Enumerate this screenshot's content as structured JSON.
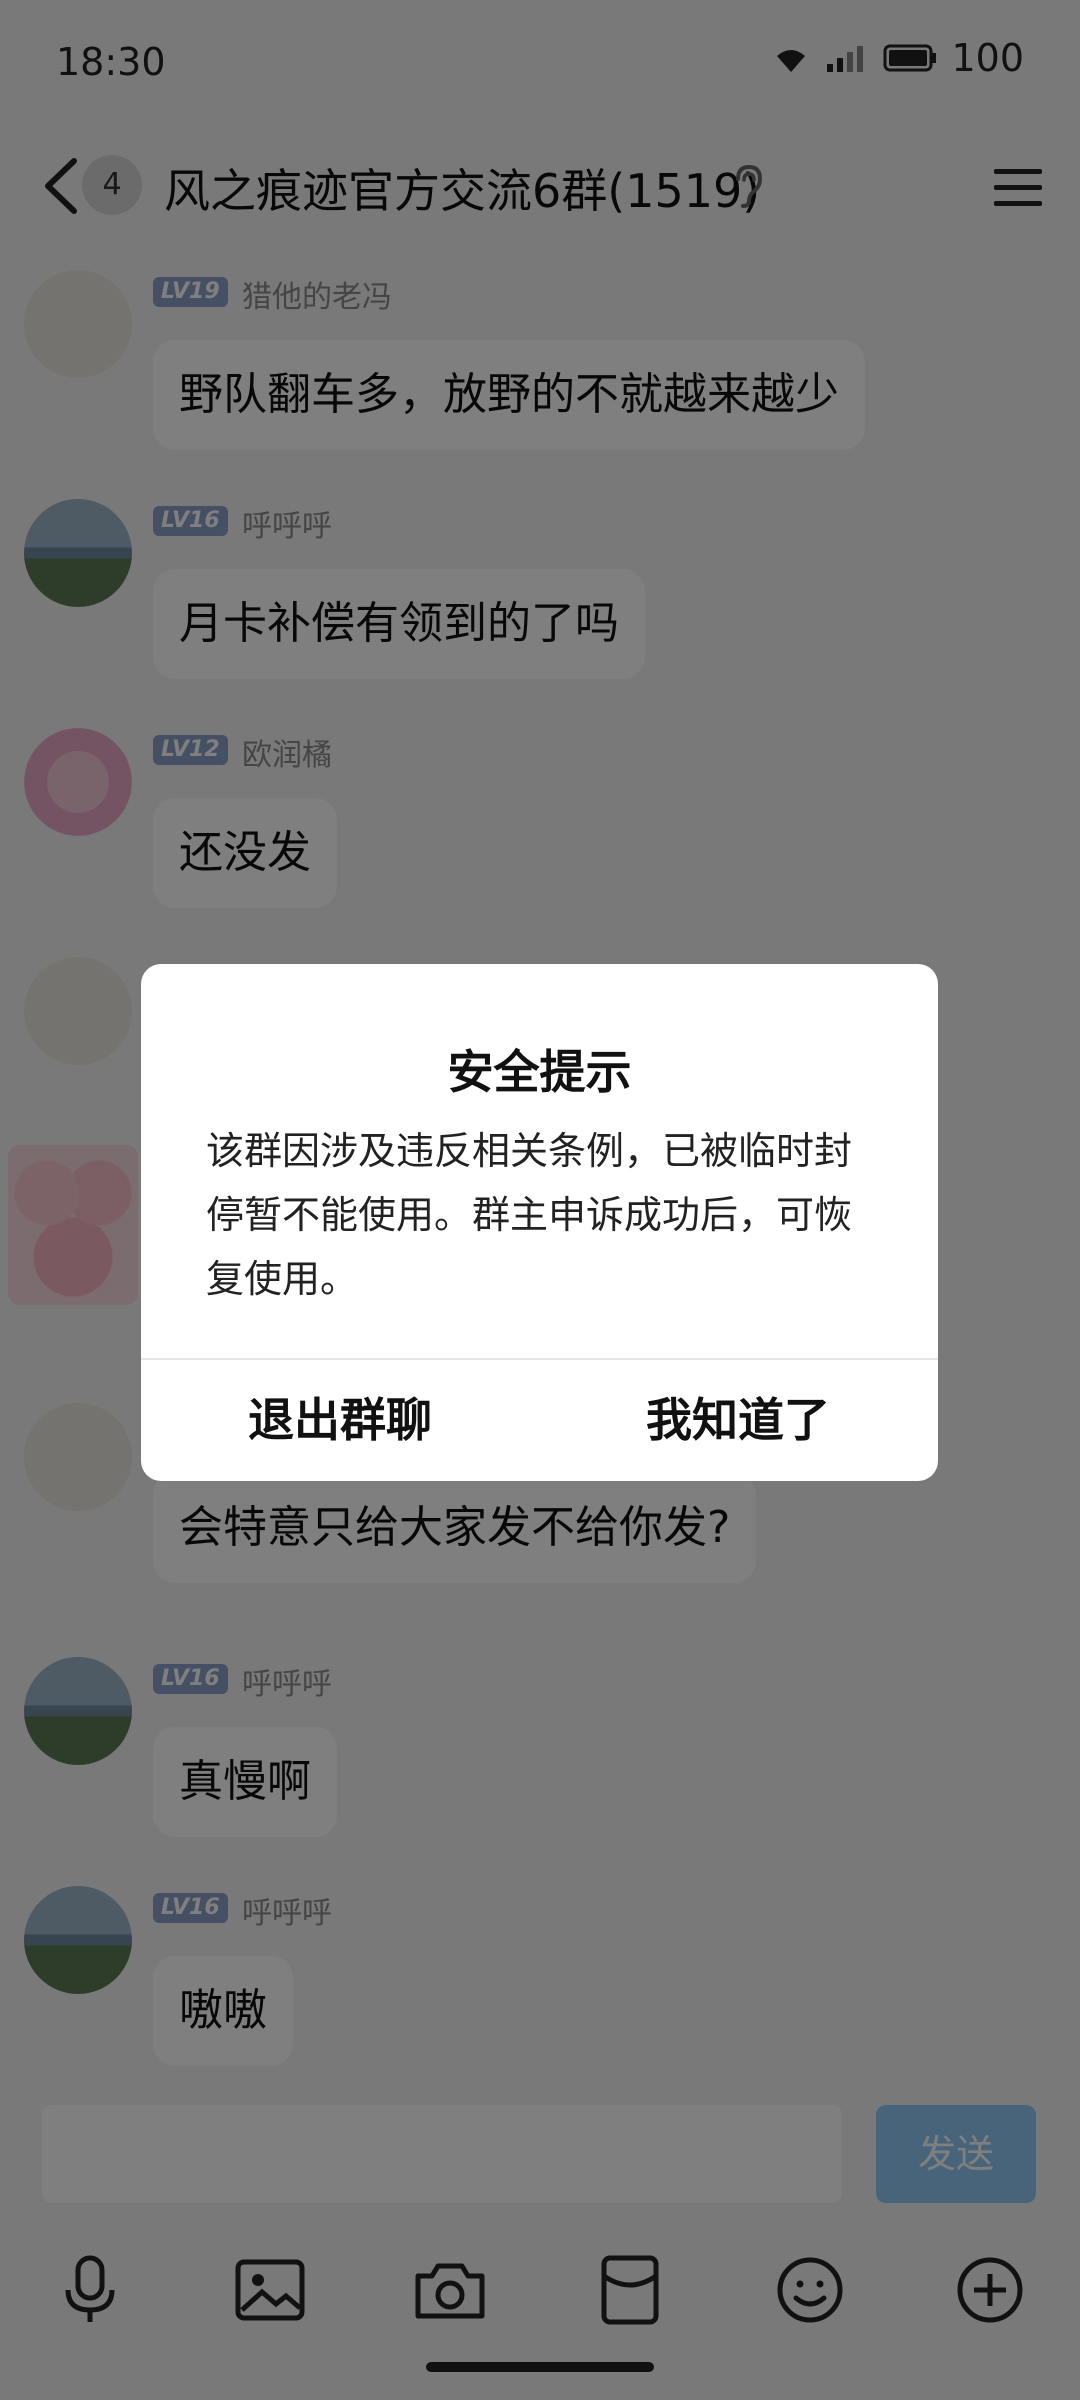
{
  "status": {
    "time": "18:30",
    "battery": "100"
  },
  "header": {
    "unread_count": "4",
    "title": "风之痕迹官方交流6群(1519)"
  },
  "messages": [
    {
      "level": "LV19",
      "name": "猎他的老冯",
      "text": "野队翻车多，放野的不就越来越少"
    },
    {
      "level": "LV16",
      "name": "呼呼呼",
      "text": "月卡补偿有领到的了吗"
    },
    {
      "level": "LV12",
      "name": "欧润橘",
      "text": "还没发"
    },
    {
      "level": "",
      "name": "",
      "text": "会特意只给大家发不给你发?"
    },
    {
      "level": "LV16",
      "name": "呼呼呼",
      "text": "真慢啊"
    },
    {
      "level": "LV16",
      "name": "呼呼呼",
      "text": "嗷嗷"
    }
  ],
  "input": {
    "send_label": "发送"
  },
  "dialog": {
    "title": "安全提示",
    "body": "该群因涉及违反相关条例，已被临时封停暂不能使用。群主申诉成功后，可恢复使用。",
    "exit_label": "退出群聊",
    "ok_label": "我知道了"
  }
}
